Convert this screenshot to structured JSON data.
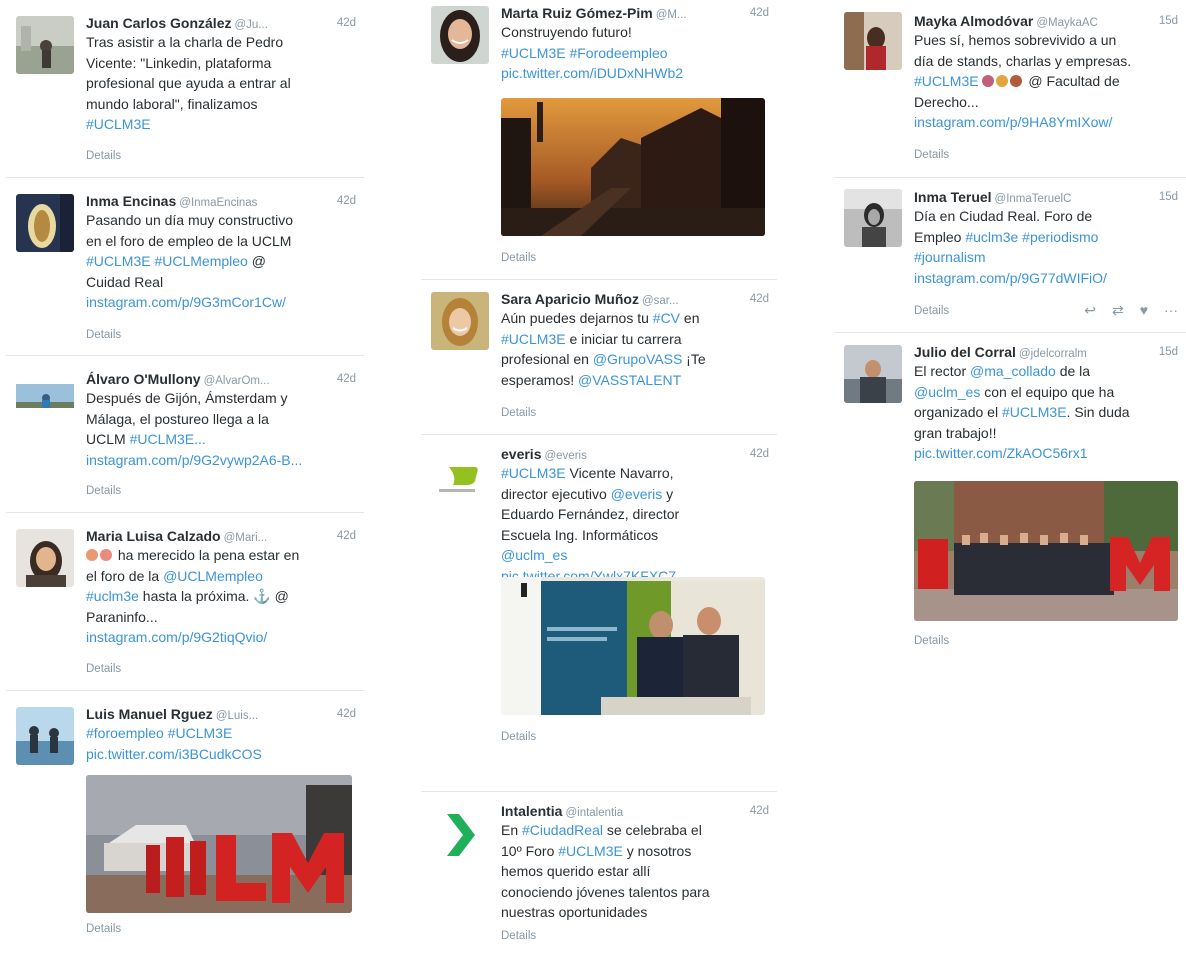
{
  "details_label": "Details",
  "col1": [
    {
      "name": "Juan Carlos González",
      "handle": "@Ju...",
      "time": "42d",
      "lines": [
        "Tras asistir a la charla de Pedro",
        "Vicente: \"Linkedin, plataforma",
        "profesional que ayuda a entrar al",
        "mundo laboral\", finalizamos"
      ],
      "hashtag": "#UCLM3E"
    },
    {
      "name": "Inma Encinas",
      "handle": "@InmaEncinas",
      "time": "42d",
      "lines": [
        "Pasando un día muy constructivo",
        "en el foro de empleo de la UCLM"
      ],
      "tags_line": "#UCLM3E #UCLMempleo",
      "tags_after": " @",
      "line_after": "Cuidad Real",
      "link": "instagram.com/p/9G3mCor1Cw/"
    },
    {
      "name": "Álvaro O'Mullony",
      "handle": "@AlvarOm...",
      "time": "42d",
      "lines": [
        "Después de Gijón, Ámsterdam y",
        "Málaga, el postureo llega a la"
      ],
      "last_plain": "UCLM ",
      "last_tag": "#UCLM3E...",
      "link": "instagram.com/p/9G2vywp2A6-B..."
    },
    {
      "name": "Maria Luisa Calzado",
      "handle": "@Mari...",
      "time": "42d",
      "line1": " ha merecido la pena estar en",
      "line2_plain": "el foro de la ",
      "line2_tag": "@UCLMempleo",
      "line3_tag": "#uclm3e",
      "line3_plain": "  hasta la próxima. ⚓ @",
      "line4": "Paraninfo...",
      "link": "instagram.com/p/9G2tiqQvio/"
    },
    {
      "name": "Luis Manuel Rguez",
      "handle": "@Luis...",
      "time": "42d",
      "tags_line": "#foroempleo #UCLM3E",
      "link": "pic.twitter.com/i3BCudkCOS"
    }
  ],
  "col2": [
    {
      "name": "Marta Ruiz Gómez-Pim",
      "handle": "@M...",
      "time": "42d",
      "line1": "Construyendo futuro!",
      "tags_line": "#UCLM3E #Forodeempleo",
      "link": "pic.twitter.com/iDUDxNHWb2"
    },
    {
      "name": "Sara Aparicio Muñoz",
      "handle": "@sar...",
      "time": "42d",
      "l1_plain": "Aún puedes dejarnos tu ",
      "l1_tag": "#CV",
      "l1_end": " en",
      "l2_tag": "#UCLM3E",
      "l2_plain": " e iniciar tu carrera",
      "l3_plain": "profesional en ",
      "l3_tag": "@GrupoVASS",
      "l3_end": " ¡Te",
      "l4_plain": "esperamos! ",
      "l4_tag": "@VASSTALENT"
    },
    {
      "name": "everis",
      "handle": "@everis",
      "time": "42d",
      "l1_tag": "#UCLM3E",
      "l1_plain": " Vicente Navarro,",
      "l2_plain": "director ejecutivo ",
      "l2_tag": "@everis",
      "l2_end": " y",
      "l3": "Eduardo Fernández, director",
      "l4": "Escuela Ing. Informáticos",
      "l5_tag": "@uclm_es",
      "link": "pic.twitter.com/Ywlx7KFXC7"
    },
    {
      "name": "Intalentia",
      "handle": "@intalentia",
      "time": "42d",
      "l1_plain": "En ",
      "l1_tag": "#CiudadReal",
      "l1_end": " se celebraba el",
      "l2_plain": "10º Foro ",
      "l2_tag": "#UCLM3E",
      "l2_end": " y nosotros",
      "l3": "hemos querido estar allí",
      "l4": "conociendo jóvenes talentos para",
      "l5": "nuestras oportunidades"
    }
  ],
  "col3": [
    {
      "name": "Mayka Almodóvar",
      "handle": "@MaykaAC",
      "time": "15d",
      "line1": "Pues sí, hemos sobrevivido a un",
      "line2": "día de stands, charlas y empresas.",
      "l3_tag": "#UCLM3E",
      "l3_end": " @ Facultad de",
      "line4": "Derecho...",
      "link": "instagram.com/p/9HA8YmIXow/"
    },
    {
      "name": "Inma Teruel",
      "handle": "@InmaTeruelC",
      "time": "15d",
      "line1": "Día en Ciudad Real. Foro de",
      "l2_plain": "Empleo ",
      "l2_tag": "#uclm3e #periodismo",
      "l3_tag": "#journalism",
      "link": "instagram.com/p/9G77dWIFiO/",
      "actions": [
        "reply-icon",
        "retweet-icon",
        "like-icon",
        "more-icon"
      ]
    },
    {
      "name": "Julio del Corral",
      "handle": "@jdelcorralm",
      "time": "15d",
      "l1_plain": "El rector ",
      "l1_tag": "@ma_collado",
      "l1_end": " de la",
      "l2_tag": "@uclm_es",
      "l2_plain": " con el equipo que ha",
      "l3_plain": "organizado el ",
      "l3_tag": "#UCLM3E",
      "l3_end": ". Sin duda",
      "line4": "gran trabajo!!",
      "link": "pic.twitter.com/ZkAOC56rx1"
    }
  ]
}
